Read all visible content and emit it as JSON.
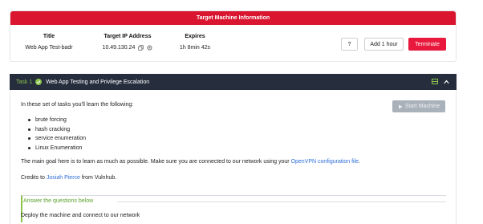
{
  "target": {
    "header": "Target Machine Information",
    "columns": {
      "title_label": "Title",
      "title_value": "Web App Test-badr",
      "ip_label": "Target IP Address",
      "ip_value": "10.49.130.24",
      "expires_label": "Expires",
      "expires_value": "1h 8min 42s"
    },
    "buttons": {
      "help": "?",
      "add_hour": "Add 1 hour",
      "terminate": "Terminate"
    },
    "colors": {
      "header": "#d9152f",
      "terminate": "#e8193c"
    }
  },
  "task": {
    "number": "Task 1",
    "title": "Web App Testing and Privilege Escalation",
    "intro": "In these set of tasks you'll learn the following:",
    "start_button": "Start Machine",
    "bullets": [
      "brute forcing",
      "hash cracking",
      "service enumeration",
      "Linux Enumeration"
    ],
    "goal_prefix": "The main goal here is to learn as much as possible. Make sure you are connected to our network using your ",
    "goal_link": "OpenVPN configuration file",
    "goal_suffix": ".",
    "credits_prefix": "Credits to ",
    "credits_link": "Josiah Pierce",
    "credits_suffix": " from Vulnhub.",
    "answer_heading": "Answer the questions below",
    "question_1": "Deploy the machine and connect to our network",
    "colors": {
      "bar": "#262e3e",
      "accent": "#8bc34a",
      "link": "#2f6fd6"
    }
  },
  "icons": {
    "copy": "copy-icon",
    "ip_status": "refresh-icon",
    "check": "check-circle-icon",
    "task_badge": "task-status-icon",
    "collapse": "chevron-up-icon",
    "start": "play-icon"
  }
}
